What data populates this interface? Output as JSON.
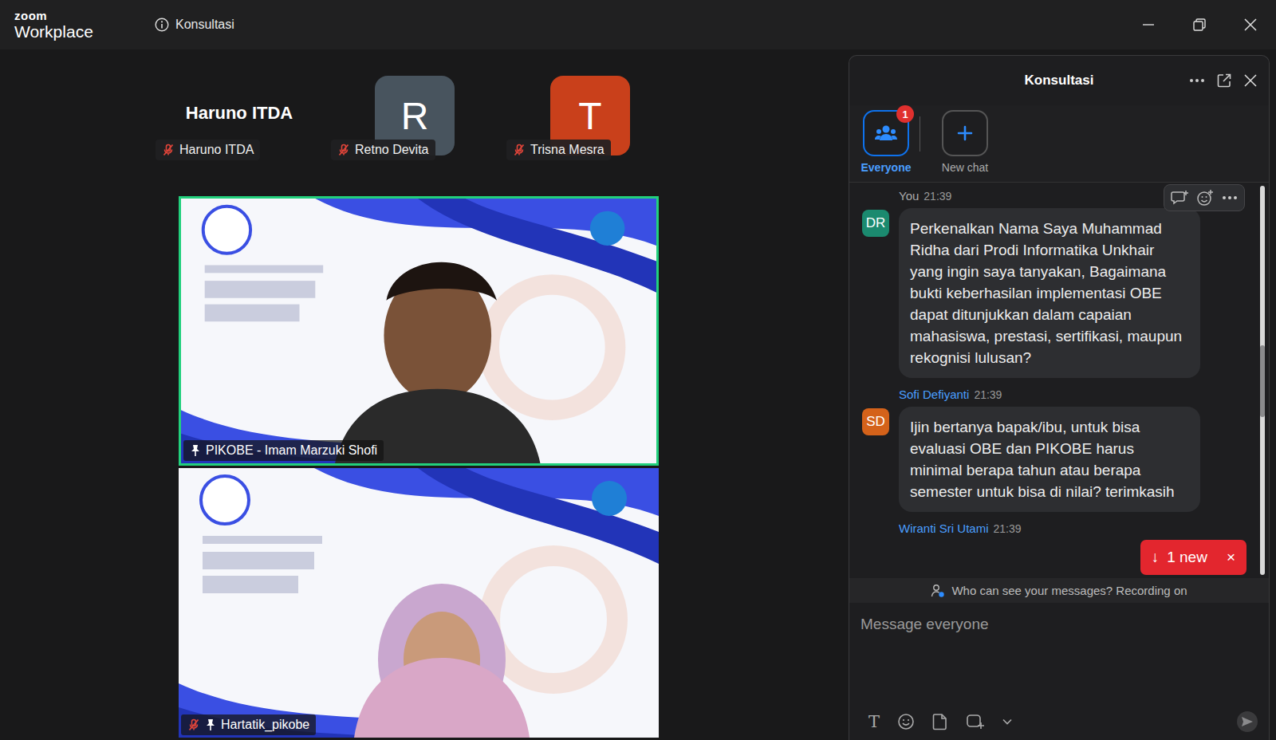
{
  "window": {
    "logo_top": "zoom",
    "logo_bottom": "Workplace",
    "title": "Konsultasi"
  },
  "participants": [
    {
      "name": "Haruno ITDA",
      "display": "Haruno ITDA",
      "kind": "name",
      "muted": true
    },
    {
      "name": "Retno Devita",
      "display": "R",
      "kind": "avatar",
      "color": "#48545e",
      "muted": true
    },
    {
      "name": "Trisna Mesra",
      "display": "T",
      "kind": "avatar",
      "color": "#c9401b",
      "muted": true
    }
  ],
  "videos": [
    {
      "label": "PIKOBE - Imam Marzuki Shofi",
      "pinned": true,
      "muted": false,
      "active_speaker": true
    },
    {
      "label": "Hartatik_pikobe",
      "pinned": true,
      "muted": true,
      "active_speaker": false
    }
  ],
  "chat": {
    "title": "Konsultasi",
    "tabs": [
      {
        "label": "Everyone",
        "badge": "1",
        "selected": true
      },
      {
        "label": "New chat",
        "selected": false
      }
    ],
    "messages": [
      {
        "kind": "full",
        "sender": "You",
        "time": "21:39",
        "initials": "DR",
        "color": "#1b8a6f",
        "self": true,
        "hovered": true,
        "text": "Perkenalkan Nama Saya Muhammad Ridha dari Prodi Informatika Unkhair yang ingin saya tanyakan, Bagaimana bukti keberhasilan implementasi OBE dapat ditunjukkan dalam capaian mahasiswa, prestasi, sertifikasi, maupun rekognisi lulusan?"
      },
      {
        "kind": "full",
        "sender": "Sofi Defiyanti",
        "time": "21:39",
        "initials": "SD",
        "color": "#d4621a",
        "self": false,
        "hovered": false,
        "text": "Ijin bertanya bapak/ibu, untuk bisa evaluasi OBE dan PIKOBE harus minimal berapa tahun atau berapa semester untuk bisa di nilai? terimkasih"
      },
      {
        "kind": "header",
        "sender": "Wiranti Sri Utami",
        "time": "21:39",
        "self": false,
        "hovered": false
      }
    ],
    "new_messages": {
      "arrow": "↓",
      "label": "1 new",
      "close": "×"
    },
    "notice": "Who can see your messages? Recording on",
    "input": {
      "placeholder": "Message everyone",
      "format_icon": "T"
    }
  }
}
